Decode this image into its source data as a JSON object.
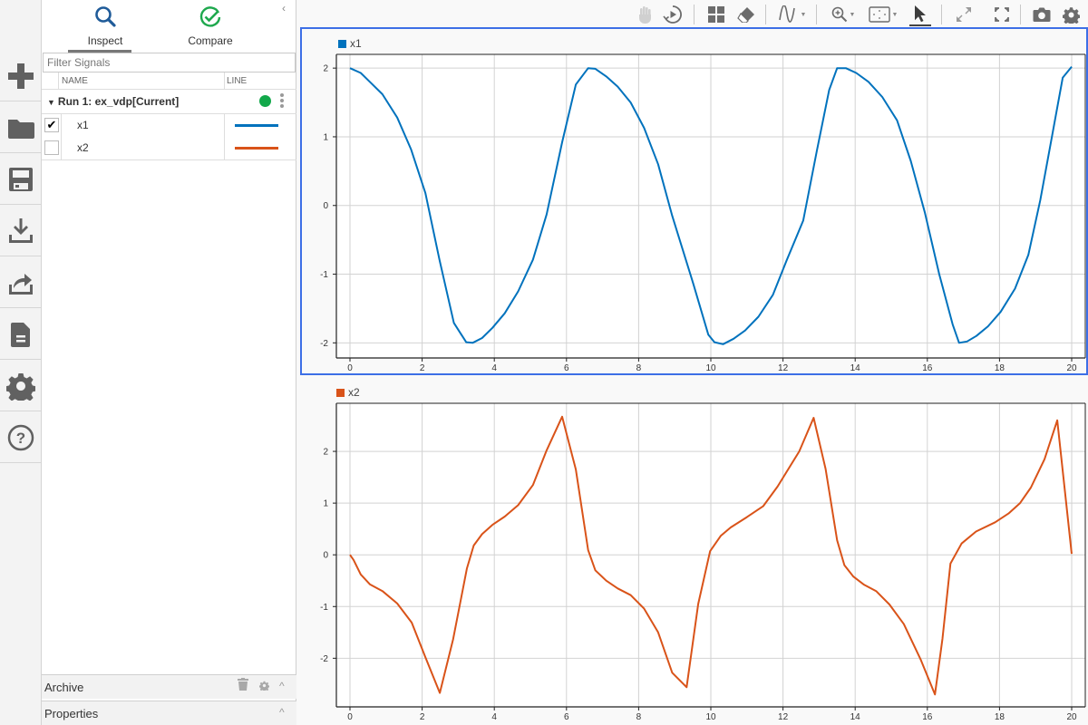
{
  "sidebar_rail": {
    "items": [
      {
        "name": "new",
        "icon": "plus-icon"
      },
      {
        "name": "open",
        "icon": "folder-icon"
      },
      {
        "name": "save",
        "icon": "save-icon"
      },
      {
        "name": "import",
        "icon": "download-icon"
      },
      {
        "name": "export",
        "icon": "share-icon"
      },
      {
        "name": "report",
        "icon": "document-icon"
      },
      {
        "name": "preferences",
        "icon": "gear-icon"
      },
      {
        "name": "help",
        "icon": "help-icon"
      }
    ]
  },
  "panel": {
    "tabs": [
      {
        "label": "Inspect",
        "icon": "search-icon",
        "active": true
      },
      {
        "label": "Compare",
        "icon": "check-circle-icon",
        "active": false
      }
    ],
    "filter_placeholder": "Filter Signals",
    "filter_value": "",
    "columns": {
      "name": "NAME",
      "line": "LINE"
    },
    "run": {
      "label": "Run 1: ex_vdp[Current]",
      "status_color": "#12a84a"
    },
    "signals": [
      {
        "name": "x1",
        "checked": true,
        "color": "#0072bd"
      },
      {
        "name": "x2",
        "checked": false,
        "color": "#d95319"
      }
    ],
    "archive_label": "Archive",
    "properties_label": "Properties"
  },
  "toolbar": {
    "buttons": [
      "pan-icon",
      "replay-icon",
      "layout-icon",
      "clear-icon",
      "signal-icon",
      "zoom-icon",
      "fit-icon",
      "cursor-icon",
      "expand-icon",
      "fullscreen-icon",
      "camera-icon",
      "settings-icon"
    ],
    "active": "cursor-icon"
  },
  "chart_data": [
    {
      "type": "line",
      "title": "",
      "legend": "x1",
      "legend_position": "top-left",
      "color": "#0072bd",
      "xlim": [
        0,
        20
      ],
      "ylim": [
        -2.22,
        2.2
      ],
      "xticks": [
        0,
        2,
        4,
        6,
        8,
        10,
        12,
        14,
        16,
        18,
        20
      ],
      "yticks": [
        -2,
        -1,
        0,
        1,
        2
      ],
      "grid": true,
      "selected": true,
      "x": [
        0,
        0.3,
        0.55,
        0.9,
        1.31,
        1.69,
        2.09,
        2.48,
        2.88,
        3.22,
        3.4,
        3.66,
        3.95,
        4.29,
        4.66,
        5.07,
        5.45,
        5.88,
        6.26,
        6.6,
        6.8,
        7.1,
        7.42,
        7.78,
        8.15,
        8.54,
        8.93,
        9.52,
        9.93,
        10.1,
        10.34,
        10.63,
        10.95,
        11.32,
        11.72,
        12.1,
        12.56,
        12.94,
        13.28,
        13.5,
        13.74,
        14.03,
        14.37,
        14.75,
        15.16,
        15.54,
        15.93,
        16.33,
        16.7,
        16.88,
        17.1,
        17.36,
        17.68,
        18.03,
        18.43,
        18.8,
        19.13,
        19.48,
        19.75,
        20.0
      ],
      "values": [
        2.0,
        1.93,
        1.8,
        1.62,
        1.28,
        0.82,
        0.18,
        -0.79,
        -1.71,
        -1.99,
        -2.0,
        -1.93,
        -1.78,
        -1.57,
        -1.25,
        -0.79,
        -0.13,
        0.92,
        1.76,
        2.0,
        1.99,
        1.88,
        1.73,
        1.5,
        1.13,
        0.6,
        -0.15,
        -1.15,
        -1.88,
        -1.99,
        -2.02,
        -1.94,
        -1.82,
        -1.62,
        -1.3,
        -0.8,
        -0.22,
        0.8,
        1.68,
        2.0,
        2.0,
        1.93,
        1.8,
        1.58,
        1.24,
        0.65,
        -0.1,
        -1.0,
        -1.73,
        -2.0,
        -1.98,
        -1.9,
        -1.76,
        -1.55,
        -1.21,
        -0.72,
        0.08,
        1.08,
        1.86,
        2.02
      ]
    },
    {
      "type": "line",
      "title": "",
      "legend": "x2",
      "legend_position": "top-left",
      "color": "#d95319",
      "xlim": [
        0,
        20
      ],
      "ylim": [
        -2.94,
        2.93
      ],
      "xticks": [
        0,
        2,
        4,
        6,
        8,
        10,
        12,
        14,
        16,
        18,
        20
      ],
      "yticks": [
        -2,
        -1,
        0,
        1,
        2
      ],
      "grid": true,
      "selected": false,
      "x": [
        0,
        0.1,
        0.3,
        0.55,
        0.9,
        1.31,
        1.71,
        2.09,
        2.49,
        2.86,
        3.24,
        3.43,
        3.66,
        3.95,
        4.29,
        4.66,
        5.07,
        5.45,
        5.88,
        6.26,
        6.6,
        6.8,
        7.1,
        7.42,
        7.78,
        8.15,
        8.54,
        8.93,
        9.33,
        9.65,
        9.98,
        10.28,
        10.55,
        11.0,
        11.45,
        11.85,
        12.45,
        12.85,
        13.18,
        13.5,
        13.7,
        13.95,
        14.25,
        14.58,
        14.95,
        15.35,
        15.82,
        16.21,
        16.42,
        16.64,
        16.95,
        17.35,
        17.88,
        18.25,
        18.57,
        18.87,
        19.25,
        19.6,
        20.0
      ],
      "values": [
        0.0,
        -0.1,
        -0.38,
        -0.57,
        -0.7,
        -0.94,
        -1.31,
        -1.98,
        -2.67,
        -1.63,
        -0.26,
        0.18,
        0.4,
        0.58,
        0.74,
        0.96,
        1.35,
        2.02,
        2.67,
        1.65,
        0.09,
        -0.3,
        -0.5,
        -0.65,
        -0.78,
        -1.04,
        -1.5,
        -2.28,
        -2.56,
        -0.95,
        0.07,
        0.37,
        0.53,
        0.73,
        0.94,
        1.32,
        2.0,
        2.65,
        1.66,
        0.28,
        -0.2,
        -0.42,
        -0.58,
        -0.7,
        -0.96,
        -1.34,
        -2.03,
        -2.7,
        -1.62,
        -0.17,
        0.22,
        0.45,
        0.63,
        0.8,
        1.0,
        1.3,
        1.85,
        2.6,
        0.02
      ]
    }
  ]
}
